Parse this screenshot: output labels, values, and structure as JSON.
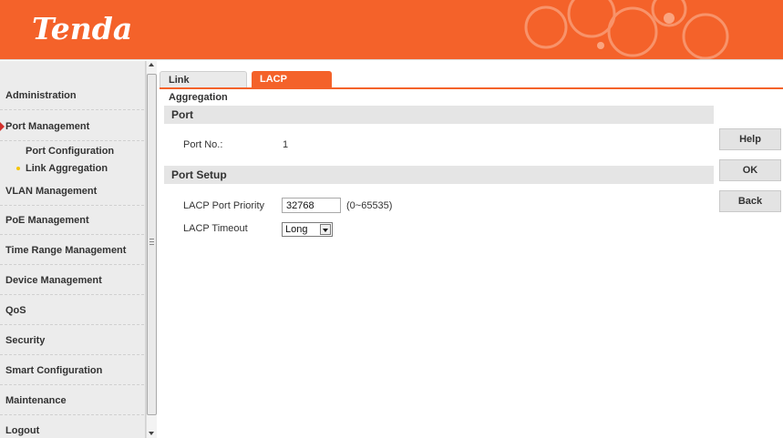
{
  "header": {
    "logo_text": "Tenda"
  },
  "sidebar": {
    "items": [
      {
        "label": "Administration"
      },
      {
        "label": "Port Management"
      },
      {
        "label": "Port Configuration"
      },
      {
        "label": "Link Aggregation"
      },
      {
        "label": "VLAN Management"
      },
      {
        "label": "PoE Management"
      },
      {
        "label": "Time Range Management"
      },
      {
        "label": "Device Management"
      },
      {
        "label": "QoS"
      },
      {
        "label": "Security"
      },
      {
        "label": "Smart Configuration"
      },
      {
        "label": "Maintenance"
      },
      {
        "label": "Logout"
      }
    ]
  },
  "tabs": [
    {
      "label": "Link Aggregation"
    },
    {
      "label": "LACP Protocol"
    }
  ],
  "port_section": {
    "title": "Port",
    "port_no_label": "Port No.:",
    "port_no_value": "1"
  },
  "setup_section": {
    "title": "Port Setup",
    "priority_label": "LACP Port Priority",
    "priority_value": "32768",
    "priority_range": "(0~65535)",
    "timeout_label": "LACP Timeout",
    "timeout_value": "Long"
  },
  "buttons": {
    "help": "Help",
    "ok": "OK",
    "back": "Back"
  },
  "colors": {
    "accent": "#f4622a",
    "arrow": "#d2302c",
    "bullet": "#f5c400"
  }
}
